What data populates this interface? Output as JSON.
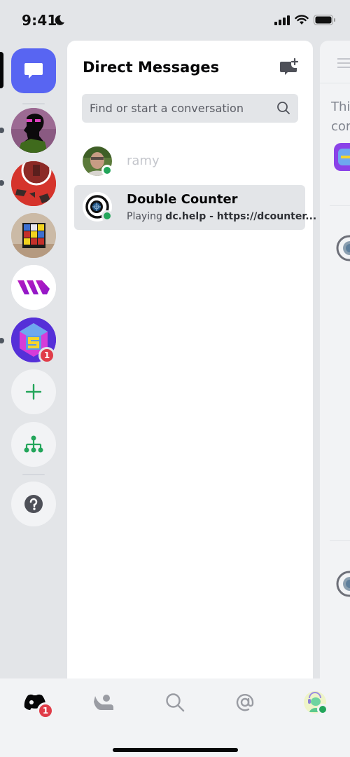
{
  "status_bar": {
    "time": "9:41",
    "focus_mode": "moon-icon",
    "signal": "cellular-signal-icon",
    "wifi": "wifi-icon",
    "battery": "battery-icon"
  },
  "rail": {
    "home": {
      "label": "Direct Messages",
      "icon": "chat-bubble-icon",
      "selected": true
    },
    "servers": [
      {
        "name": "Dark silhouette server",
        "unread": true
      },
      {
        "name": "Red server",
        "unread": true
      },
      {
        "name": "Rubik's cube server",
        "unread": false
      },
      {
        "name": "W server",
        "unread": false
      },
      {
        "name": "Hex S server",
        "unread": true,
        "mentions": "1"
      }
    ],
    "actions": [
      {
        "name": "add-server",
        "icon": "plus-icon"
      },
      {
        "name": "explore-servers",
        "icon": "hierarchy-icon"
      },
      {
        "name": "help",
        "icon": "question-icon"
      }
    ]
  },
  "dm_panel": {
    "title": "Direct Messages",
    "new_dm_icon": "new-message-icon",
    "search": {
      "placeholder": "Find or start a conversation",
      "value": ""
    },
    "conversations": [
      {
        "name": "ramy",
        "status": "online",
        "activity": "",
        "muted": true,
        "active": false
      },
      {
        "name": "Double Counter",
        "status": "online",
        "activity_prefix": "Playing ",
        "activity_game": "dc.help - https://dcounter...",
        "muted": false,
        "active": true
      }
    ]
  },
  "peek_panel": {
    "line1": "Thi",
    "line2": "cor"
  },
  "tab_bar": {
    "tabs": [
      {
        "name": "home",
        "icon": "discord-home-icon",
        "badge": "1",
        "selected": true
      },
      {
        "name": "friends",
        "icon": "friends-icon"
      },
      {
        "name": "search",
        "icon": "search-icon"
      },
      {
        "name": "mentions",
        "icon": "at-icon"
      },
      {
        "name": "profile",
        "icon": "avatar",
        "status": "online"
      }
    ]
  },
  "colors": {
    "brand": "#5865f2",
    "online": "#23a55a",
    "badge": "#e03c48",
    "green_action": "#23a55a"
  }
}
